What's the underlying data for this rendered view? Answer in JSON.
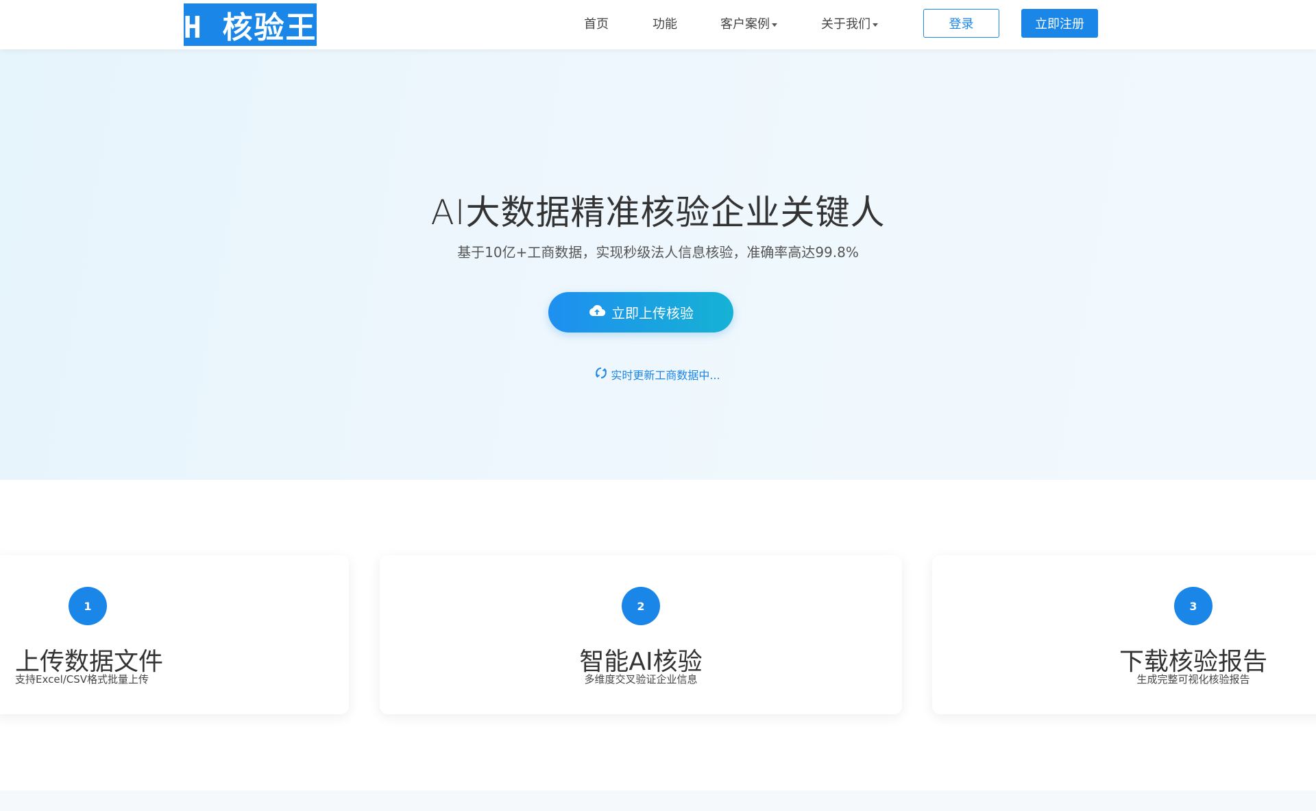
{
  "header": {
    "logo_text": "H 核验王",
    "nav": [
      {
        "label": "首页",
        "dropdown": false
      },
      {
        "label": "功能",
        "dropdown": false
      },
      {
        "label": "客户案例",
        "dropdown": true
      },
      {
        "label": "关于我们",
        "dropdown": true
      }
    ],
    "login_label": "登录",
    "register_label": "立即注册"
  },
  "hero": {
    "title": "AI大数据精准核验企业关键人",
    "subtitle": "基于10亿+工商数据，实现秒级法人信息核验，准确率高达99.8%",
    "upload_button_label": "立即上传核验",
    "upload_icon": "cloud-upload-icon",
    "status_text": "实时更新工商数据中...",
    "status_icon": "sync-icon"
  },
  "steps": [
    {
      "number": "1",
      "title": "上传数据文件",
      "description": "支持Excel/CSV格式批量上传"
    },
    {
      "number": "2",
      "title": "智能AI核验",
      "description": "多维度交叉验证企业信息"
    },
    {
      "number": "3",
      "title": "下载核验报告",
      "description": "生成完整可视化核验报告"
    }
  ],
  "colors": {
    "primary": "#1a86e8",
    "gradient_end": "#16b2d4",
    "hero_background": "#eef7fd"
  }
}
